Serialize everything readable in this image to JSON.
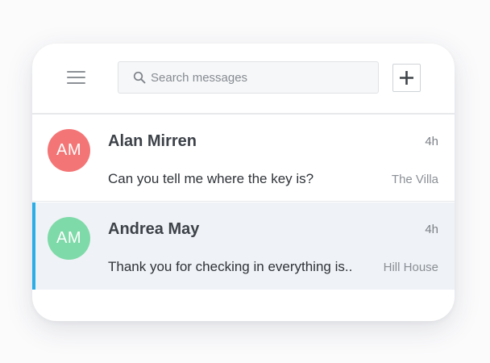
{
  "search": {
    "placeholder": "Search messages",
    "value": ""
  },
  "add_button": {
    "label": "+"
  },
  "conversations": [
    {
      "initials": "AM",
      "name": "Alan Mirren",
      "time": "4h",
      "preview": "Can you tell me where the key is?",
      "location": "The Villa",
      "avatar_color": "#f47576",
      "selected": false
    },
    {
      "initials": "AM",
      "name": "Andrea May",
      "time": "4h",
      "preview": "Thank you for checking in everything is..",
      "location": "Hill House",
      "avatar_color": "#7edaa8",
      "selected": true
    }
  ],
  "colors": {
    "selected_row_bg": "#eff2f6",
    "selected_accent": "#29aee8"
  }
}
